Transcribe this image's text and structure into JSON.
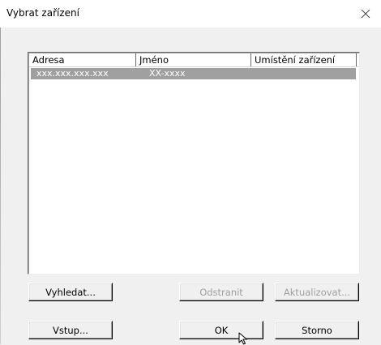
{
  "window": {
    "title": "Vybrat zařízení"
  },
  "device_list": {
    "columns": [
      "Adresa",
      "Jméno",
      "Umístění zařízení"
    ],
    "rows": [
      {
        "address": "xxx.xxx.xxx.xxx",
        "name": "XX-xxxx",
        "location": ""
      }
    ]
  },
  "buttons": {
    "search": "Vyhledat...",
    "remove": "Odstranit",
    "update": "Aktualizovat...",
    "input": "Vstup...",
    "ok": "OK",
    "cancel": "Storno"
  },
  "states": {
    "remove_enabled": false,
    "update_enabled": false,
    "row_0_selected": true
  },
  "icons": {
    "close": "close-icon",
    "cursor": "mouse-pointer-icon"
  },
  "colors": {
    "selection": "#a0a0a0",
    "disabled_text": "#a0a0a0",
    "window_bg": "#f0f0f0"
  }
}
